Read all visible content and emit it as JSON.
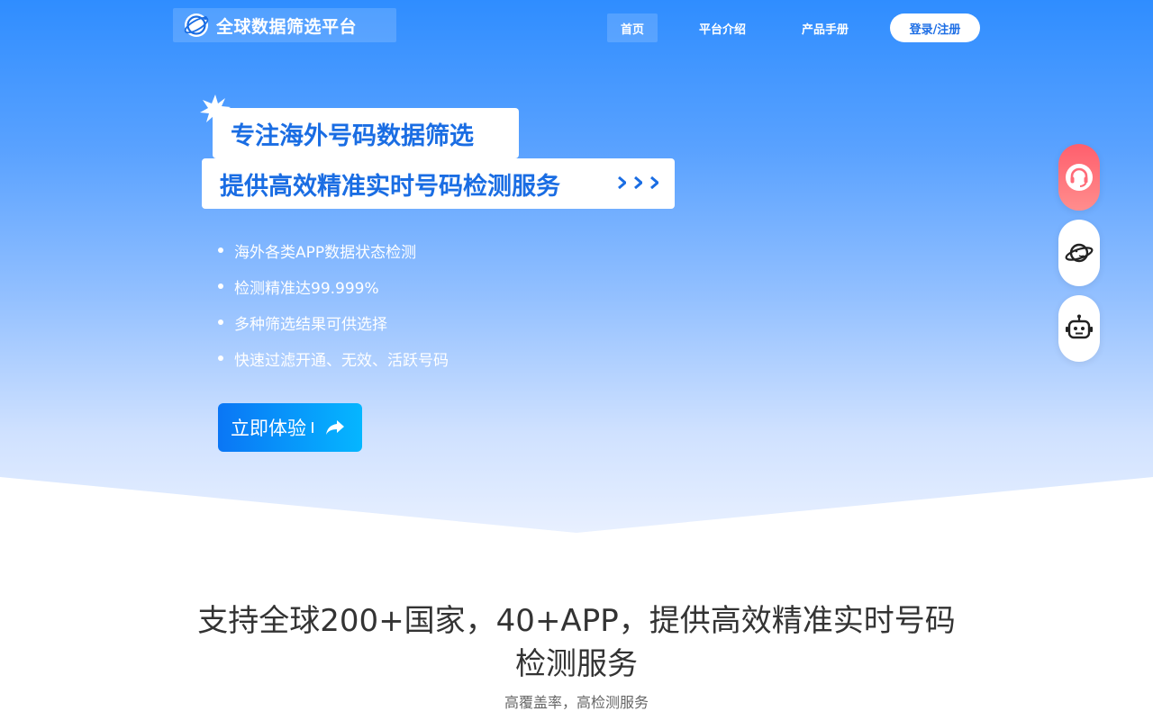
{
  "header": {
    "logo_text": "全球数据筛选平台",
    "nav": [
      {
        "label": "首页",
        "active": true
      },
      {
        "label": "平台介绍",
        "active": false
      },
      {
        "label": "产品手册",
        "active": false
      }
    ],
    "login_label": "登录/注册"
  },
  "hero": {
    "headline_1": "专注海外号码数据筛选",
    "headline_2": "提供高效精准实时号码检测服务",
    "bullets": [
      "海外各类APP数据状态检测",
      "检测精准达99.999%",
      "多种筛选结果可供选择",
      "快速过滤开通、无效、活跃号码"
    ],
    "cta_label": "立即体验"
  },
  "side_widgets": [
    "headset-icon",
    "planet-icon",
    "robot-icon"
  ],
  "section": {
    "title_line1": "支持全球200+国家，40+APP，提供高效精准实时号码",
    "title_line2": "检测服务",
    "subtitle": "高覆盖率，高检测服务"
  },
  "colors": {
    "primary": "#1a6de3",
    "hero_top": "#2f8dff",
    "support_widget": "#ff6b78"
  }
}
